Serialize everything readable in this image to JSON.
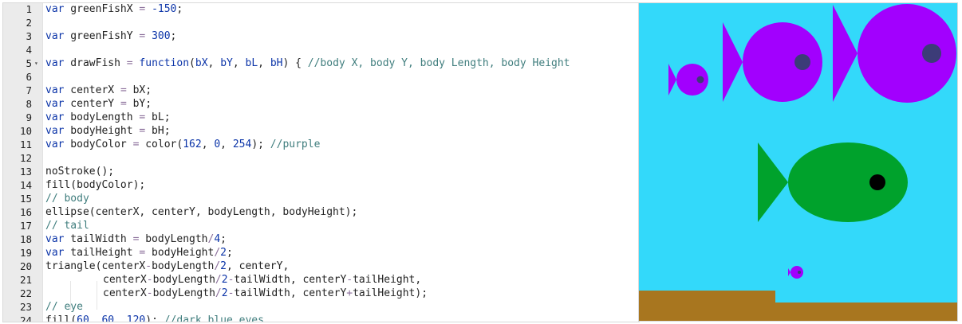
{
  "editor": {
    "lines": [
      {
        "n": "1",
        "tokens": [
          [
            "kw",
            "var"
          ],
          [
            "t",
            " greenFishX "
          ],
          [
            "op",
            "="
          ],
          [
            "t",
            " "
          ],
          [
            "num",
            "-150"
          ],
          [
            "t",
            ";"
          ]
        ]
      },
      {
        "n": "2",
        "tokens": []
      },
      {
        "n": "3",
        "tokens": [
          [
            "kw",
            "var"
          ],
          [
            "t",
            " greenFishY "
          ],
          [
            "op",
            "="
          ],
          [
            "t",
            " "
          ],
          [
            "num",
            "300"
          ],
          [
            "t",
            ";"
          ]
        ]
      },
      {
        "n": "4",
        "tokens": []
      },
      {
        "n": "5",
        "fold": true,
        "tokens": [
          [
            "kw",
            "var"
          ],
          [
            "t",
            " drawFish "
          ],
          [
            "op",
            "="
          ],
          [
            "t",
            " "
          ],
          [
            "kw",
            "function"
          ],
          [
            "t",
            "("
          ],
          [
            "kw",
            "bX"
          ],
          [
            "t",
            ", "
          ],
          [
            "kw",
            "bY"
          ],
          [
            "t",
            ", "
          ],
          [
            "kw",
            "bL"
          ],
          [
            "t",
            ", "
          ],
          [
            "kw",
            "bH"
          ],
          [
            "t",
            ") { "
          ],
          [
            "cm",
            "//body X, body Y, body Length, body Height"
          ]
        ]
      },
      {
        "n": "6",
        "tokens": []
      },
      {
        "n": "7",
        "tokens": [
          [
            "kw",
            "var"
          ],
          [
            "t",
            " centerX "
          ],
          [
            "op",
            "="
          ],
          [
            "t",
            " bX;"
          ]
        ]
      },
      {
        "n": "8",
        "tokens": [
          [
            "kw",
            "var"
          ],
          [
            "t",
            " centerY "
          ],
          [
            "op",
            "="
          ],
          [
            "t",
            " bY;"
          ]
        ]
      },
      {
        "n": "9",
        "tokens": [
          [
            "kw",
            "var"
          ],
          [
            "t",
            " bodyLength "
          ],
          [
            "op",
            "="
          ],
          [
            "t",
            " bL;"
          ]
        ]
      },
      {
        "n": "10",
        "tokens": [
          [
            "kw",
            "var"
          ],
          [
            "t",
            " bodyHeight "
          ],
          [
            "op",
            "="
          ],
          [
            "t",
            " bH;"
          ]
        ]
      },
      {
        "n": "11",
        "tokens": [
          [
            "kw",
            "var"
          ],
          [
            "t",
            " bodyColor "
          ],
          [
            "op",
            "="
          ],
          [
            "t",
            " color("
          ],
          [
            "num",
            "162"
          ],
          [
            "t",
            ", "
          ],
          [
            "num",
            "0"
          ],
          [
            "t",
            ", "
          ],
          [
            "num",
            "254"
          ],
          [
            "t",
            "); "
          ],
          [
            "cm",
            "//purple"
          ]
        ]
      },
      {
        "n": "12",
        "tokens": []
      },
      {
        "n": "13",
        "tokens": [
          [
            "t",
            "noStroke();"
          ]
        ]
      },
      {
        "n": "14",
        "tokens": [
          [
            "t",
            "fill(bodyColor);"
          ]
        ]
      },
      {
        "n": "15",
        "tokens": [
          [
            "cm",
            "// body"
          ]
        ]
      },
      {
        "n": "16",
        "tokens": [
          [
            "t",
            "ellipse(centerX, centerY, bodyLength, bodyHeight);"
          ]
        ]
      },
      {
        "n": "17",
        "tokens": [
          [
            "cm",
            "// tail"
          ]
        ]
      },
      {
        "n": "18",
        "tokens": [
          [
            "kw",
            "var"
          ],
          [
            "t",
            " tailWidth "
          ],
          [
            "op",
            "="
          ],
          [
            "t",
            " bodyLength"
          ],
          [
            "op",
            "/"
          ],
          [
            "num",
            "4"
          ],
          [
            "t",
            ";"
          ]
        ]
      },
      {
        "n": "19",
        "tokens": [
          [
            "kw",
            "var"
          ],
          [
            "t",
            " tailHeight "
          ],
          [
            "op",
            "="
          ],
          [
            "t",
            " bodyHeight"
          ],
          [
            "op",
            "/"
          ],
          [
            "num",
            "2"
          ],
          [
            "t",
            ";"
          ]
        ]
      },
      {
        "n": "20",
        "tokens": [
          [
            "t",
            "triangle(centerX"
          ],
          [
            "op",
            "-"
          ],
          [
            "t",
            "bodyLength"
          ],
          [
            "op",
            "/"
          ],
          [
            "num",
            "2"
          ],
          [
            "t",
            ", centerY,"
          ]
        ]
      },
      {
        "n": "21",
        "indent": true,
        "tokens": [
          [
            "t",
            "centerX"
          ],
          [
            "op",
            "-"
          ],
          [
            "t",
            "bodyLength"
          ],
          [
            "op",
            "/"
          ],
          [
            "num",
            "2"
          ],
          [
            "op",
            "-"
          ],
          [
            "t",
            "tailWidth, centerY"
          ],
          [
            "op",
            "-"
          ],
          [
            "t",
            "tailHeight,"
          ]
        ]
      },
      {
        "n": "22",
        "indent": true,
        "tokens": [
          [
            "t",
            "centerX"
          ],
          [
            "op",
            "-"
          ],
          [
            "t",
            "bodyLength"
          ],
          [
            "op",
            "/"
          ],
          [
            "num",
            "2"
          ],
          [
            "op",
            "-"
          ],
          [
            "t",
            "tailWidth, centerY"
          ],
          [
            "op",
            "+"
          ],
          [
            "t",
            "tailHeight);"
          ]
        ]
      },
      {
        "n": "23",
        "tokens": [
          [
            "cm",
            "// eye"
          ]
        ]
      },
      {
        "n": "24",
        "tokens": [
          [
            "t",
            "fill("
          ],
          [
            "num",
            "60"
          ],
          [
            "t",
            ", "
          ],
          [
            "num",
            "60"
          ],
          [
            "t",
            ", "
          ],
          [
            "num",
            "120"
          ],
          [
            "t",
            "); "
          ],
          [
            "cm",
            "//dark blue eyes"
          ]
        ]
      }
    ]
  },
  "canvas": {
    "colors": {
      "water": "#33d9fa",
      "sand": "#a8761f",
      "purple": "#a200fe",
      "green": "#00a22c",
      "dark_blue_eye": "#3c3c78",
      "black_eye": "#000000"
    },
    "fish": [
      {
        "name": "small-purple-fish",
        "color": "purple",
        "eye": "dark_blue_eye"
      },
      {
        "name": "medium-purple-fish",
        "color": "purple",
        "eye": "dark_blue_eye"
      },
      {
        "name": "large-purple-fish",
        "color": "purple",
        "eye": "dark_blue_eye"
      },
      {
        "name": "green-fish",
        "color": "green",
        "eye": "black_eye"
      },
      {
        "name": "tiny-purple-fish",
        "color": "purple",
        "eye": "dark_blue_eye"
      }
    ]
  }
}
